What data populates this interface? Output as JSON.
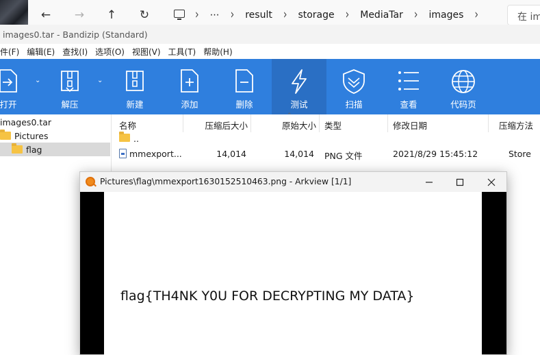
{
  "explorer": {
    "breadcrumbs": [
      "result",
      "storage",
      "MediaTar",
      "images"
    ],
    "ellipsis": "⋯",
    "search_placeholder": "在 im"
  },
  "bandizip": {
    "title": "images0.tar - Bandizip (Standard)",
    "menu": [
      "件(F)",
      "编辑(E)",
      "查找(I)",
      "选项(O)",
      "视图(V)",
      "工具(T)",
      "帮助(H)"
    ],
    "toolbar": [
      {
        "label": "打开",
        "icon": "open-icon"
      },
      {
        "label": "解压",
        "icon": "extract-icon"
      },
      {
        "label": "新建",
        "icon": "new-archive-icon"
      },
      {
        "label": "添加",
        "icon": "add-icon"
      },
      {
        "label": "删除",
        "icon": "delete-icon"
      },
      {
        "label": "测试",
        "icon": "test-lightning-icon"
      },
      {
        "label": "扫描",
        "icon": "scan-shield-icon"
      },
      {
        "label": "查看",
        "icon": "view-list-icon"
      },
      {
        "label": "代码页",
        "icon": "codepage-globe-icon"
      }
    ],
    "toolbar_active_index": 5,
    "tree": {
      "root": "images0.tar",
      "items": [
        "Pictures",
        "flag"
      ],
      "selected": "flag"
    },
    "list": {
      "columns": [
        "名称",
        "压缩后大小",
        "原始大小",
        "类型",
        "修改日期",
        "压缩方法"
      ],
      "sort_column_index": 2,
      "rows": [
        {
          "name": "..",
          "packed": "",
          "size": "",
          "type": "",
          "modified": "",
          "method": ""
        },
        {
          "name": "mmexport...",
          "packed": "14,014",
          "size": "14,014",
          "type": "PNG 文件",
          "modified": "2021/8/29 15:45:12",
          "method": "Store"
        }
      ]
    },
    "accent_color": "#2f7fde"
  },
  "arkview": {
    "title": "Pictures\\flag\\mmexport1630152510463.png - Arkview [1/1]",
    "image_text": "flag{TH4NK Y0U FOR DECRYPTING MY DATA}"
  }
}
